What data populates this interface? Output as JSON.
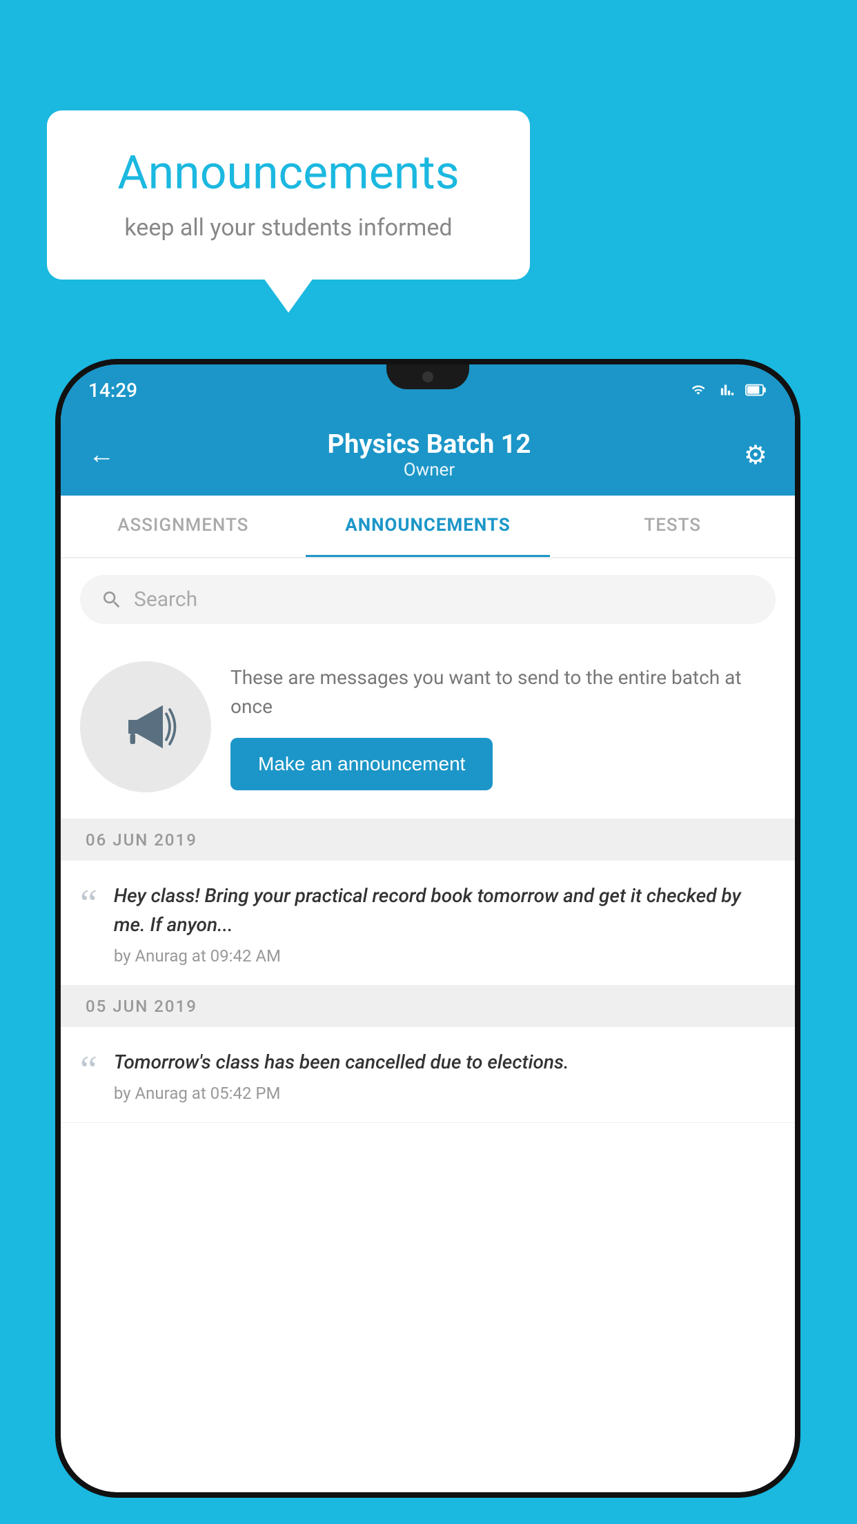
{
  "background_color": "#1BB8E0",
  "bubble": {
    "title": "Announcements",
    "subtitle": "keep all your students informed"
  },
  "phone": {
    "status_bar": {
      "time": "14:29"
    },
    "header": {
      "title": "Physics Batch 12",
      "subtitle": "Owner",
      "back_label": "←",
      "settings_label": "⚙"
    },
    "tabs": [
      {
        "label": "ASSIGNMENTS",
        "active": false
      },
      {
        "label": "ANNOUNCEMENTS",
        "active": true
      },
      {
        "label": "TESTS",
        "active": false
      }
    ],
    "search": {
      "placeholder": "Search"
    },
    "announcement_prompt": {
      "description": "These are messages you want to send to the entire batch at once",
      "button_label": "Make an announcement"
    },
    "announcements": [
      {
        "date": "06  JUN  2019",
        "text": "Hey class! Bring your practical record book tomorrow and get it checked by me. If anyon...",
        "meta": "by Anurag at 09:42 AM"
      },
      {
        "date": "05  JUN  2019",
        "text": "Tomorrow's class has been cancelled due to elections.",
        "meta": "by Anurag at 05:42 PM"
      }
    ]
  }
}
